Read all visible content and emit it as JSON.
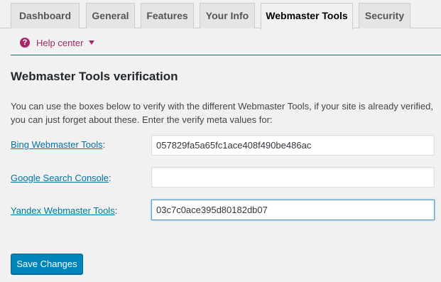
{
  "tabs": [
    {
      "label": "Dashboard",
      "active": false
    },
    {
      "label": "General",
      "active": false
    },
    {
      "label": "Features",
      "active": false
    },
    {
      "label": "Your Info",
      "active": false
    },
    {
      "label": "Webmaster Tools",
      "active": true
    },
    {
      "label": "Security",
      "active": false
    }
  ],
  "help": {
    "icon": "question-circle-icon",
    "label": "Help center",
    "caret": "caret-down-icon",
    "color": "#a4286a"
  },
  "main": {
    "heading": "Webmaster Tools verification",
    "description": "You can use the boxes below to verify with the different Webmaster Tools, if your site is already verified, you can just forget about these. Enter the verify meta values for:",
    "fields": [
      {
        "label": "Bing Webmaster Tools",
        "suffix": ":",
        "value": "057829fa5a65fc1ace408f490be486ac"
      },
      {
        "label": "Google Search Console",
        "suffix": ":",
        "value": ""
      },
      {
        "label": "Yandex Webmaster Tools",
        "suffix": ":",
        "value": "03c7c0ace395d80182db07"
      }
    ],
    "save_label": "Save Changes"
  },
  "colors": {
    "link": "#0073aa",
    "primary_button": "#0085ba",
    "accent": "#a4286a",
    "background": "#f1f1f1"
  }
}
